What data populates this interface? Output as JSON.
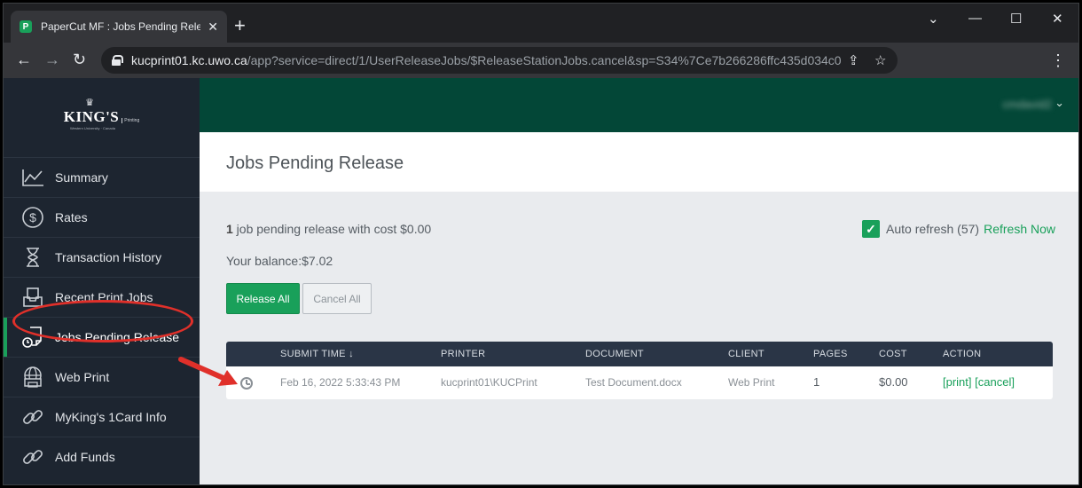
{
  "browser": {
    "tab_title": "PaperCut MF : Jobs Pending Release",
    "tab_favicon": "P",
    "new_tab": "+",
    "url_host": "kucprint01.kc.uwo.ca",
    "url_path": "/app?service=direct/1/UserReleaseJobs/$ReleaseStationJobs.cancel&sp=S34%7Ce7b266286ffc435d034c0d..."
  },
  "sidebar": {
    "logo": {
      "crown": "♛",
      "name": "KING'S",
      "sub": "Printing",
      "tagline": "Western University · Canada"
    },
    "items": [
      {
        "label": "Summary",
        "icon": "summary-chart-icon"
      },
      {
        "label": "Rates",
        "icon": "dollar-icon"
      },
      {
        "label": "Transaction History",
        "icon": "hourglass-icon"
      },
      {
        "label": "Recent Print Jobs",
        "icon": "inbox-tray-icon"
      },
      {
        "label": "Jobs Pending Release",
        "icon": "pending-document-icon",
        "active": true
      },
      {
        "label": "Web Print",
        "icon": "globe-printer-icon"
      },
      {
        "label": "MyKing's 1Card Info",
        "icon": "link-icon"
      },
      {
        "label": "Add Funds",
        "icon": "link-icon"
      }
    ]
  },
  "header": {
    "user": "cmdavid2",
    "title": "Jobs Pending Release"
  },
  "summary": {
    "count": "1",
    "text": " job pending release with cost ",
    "cost": "$0.00",
    "balance_label": "Your balance:",
    "balance_value": "$7.02",
    "auto_refresh_label": "Auto refresh (57)",
    "refresh_now": "Refresh Now"
  },
  "buttons": {
    "release_all": "Release All",
    "cancel_all": "Cancel All"
  },
  "table": {
    "headers": [
      "SUBMIT TIME",
      "PRINTER",
      "DOCUMENT",
      "CLIENT",
      "PAGES",
      "COST",
      "ACTION"
    ],
    "sort_indicator": "↓",
    "rows": [
      {
        "status_icon": "clock-icon",
        "submit_time": "Feb 16, 2022 5:33:43 PM",
        "printer": "kucprint01\\KUCPrint",
        "document": "Test Document.docx",
        "client": "Web Print",
        "pages": "1",
        "cost": "$0.00",
        "print_action": "[print]",
        "cancel_action": "[cancel]"
      }
    ]
  },
  "colors": {
    "accent": "#19a05a",
    "header_green": "#034737",
    "sidebar": "#1d2530",
    "annotation_red": "#e0302a"
  }
}
